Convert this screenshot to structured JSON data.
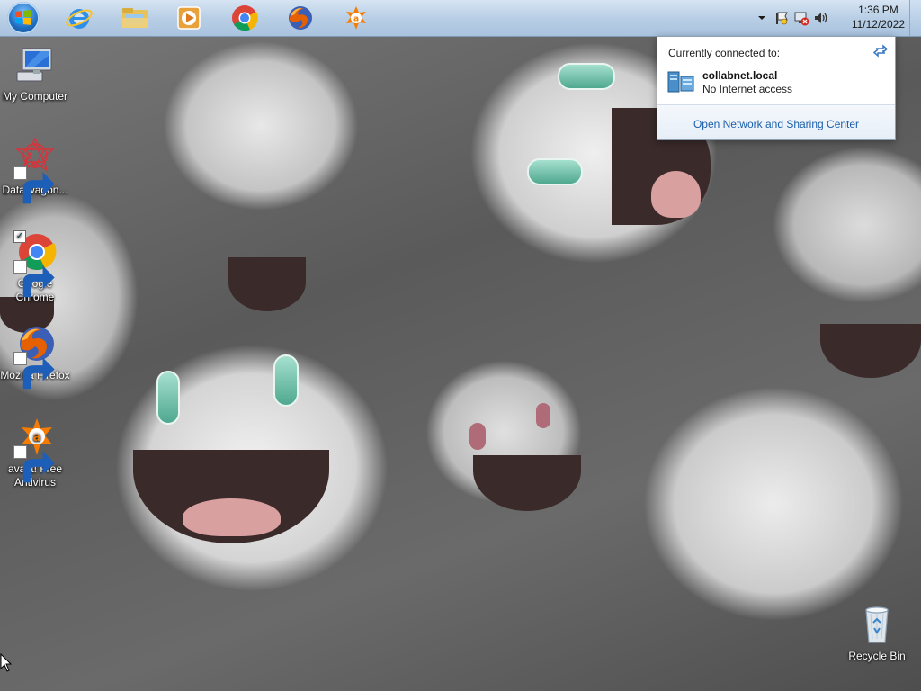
{
  "taskbar": {
    "apps": [
      {
        "name": "internet-explorer",
        "icon": "ie-icon"
      },
      {
        "name": "file-explorer",
        "icon": "folder-icon"
      },
      {
        "name": "media-player",
        "icon": "media-player-icon"
      },
      {
        "name": "google-chrome",
        "icon": "chrome-icon"
      },
      {
        "name": "mozilla-firefox",
        "icon": "firefox-icon"
      },
      {
        "name": "avast",
        "icon": "avast-icon"
      }
    ],
    "tray": {
      "time": "1:36 PM",
      "date": "11/12/2022"
    }
  },
  "desktop": {
    "icons": [
      {
        "label": "My Computer",
        "icon": "computer-icon"
      },
      {
        "label": "DataWagon...",
        "icon": "datawagon-icon"
      },
      {
        "label": "Google Chrome",
        "icon": "chrome-icon"
      },
      {
        "label": "Mozilla Firefox",
        "icon": "firefox-icon"
      },
      {
        "label": "avast! Free Antivirus",
        "icon": "avast-icon"
      },
      {
        "label": "Recycle Bin",
        "icon": "recycle-bin-icon"
      }
    ]
  },
  "network_popup": {
    "heading": "Currently connected to:",
    "network_name": "collabnet.local",
    "status": "No Internet access",
    "link": "Open Network and Sharing Center"
  },
  "colors": {
    "taskbar": "#b9cfe6",
    "link": "#1b5fab",
    "chrome_red": "#db4437",
    "chrome_green": "#0f9d58",
    "chrome_yellow": "#f4b400",
    "chrome_blue": "#4285f4",
    "firefox_orange": "#e66000",
    "avast_orange": "#f57c00"
  }
}
